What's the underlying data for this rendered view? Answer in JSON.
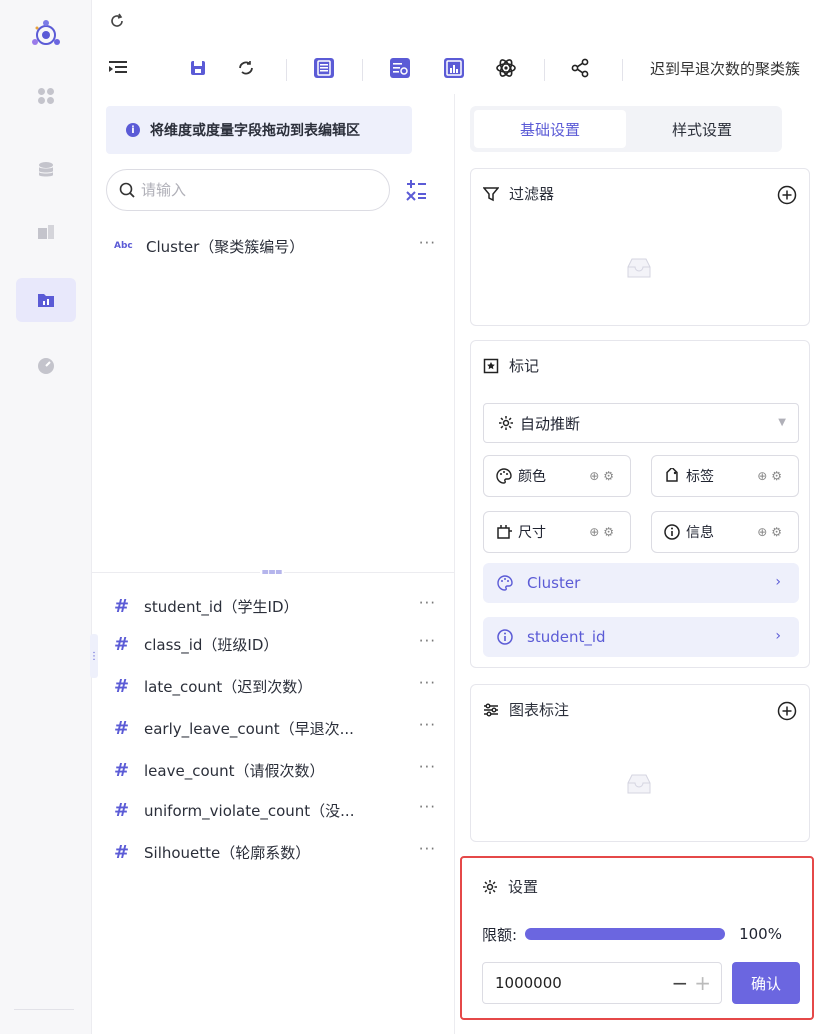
{
  "toolbar": {
    "chart_title": "迟到早退次数的聚类簇"
  },
  "fields_panel": {
    "banner_text": "将维度或度量字段拖动到表编辑区",
    "search_placeholder": "请输入",
    "dimensions": [
      {
        "type_badge": "Abc",
        "label": "Cluster（聚类簇编号）"
      }
    ],
    "measures": [
      {
        "label": "student_id（学生ID）"
      },
      {
        "label": "class_id（班级ID）"
      },
      {
        "label": "late_count（迟到次数）"
      },
      {
        "label": "early_leave_count（早退次..."
      },
      {
        "label": "leave_count（请假次数）"
      },
      {
        "label": "uniform_violate_count（没..."
      },
      {
        "label": "Silhouette（轮廓系数）"
      }
    ],
    "more_label": "···",
    "measure_symbol": "#"
  },
  "config_panel": {
    "tabs": [
      {
        "label": "基础设置",
        "active": true
      },
      {
        "label": "样式设置",
        "active": false
      }
    ],
    "filter": {
      "title": "过滤器"
    },
    "marks": {
      "title": "标记",
      "select_value": "自动推断",
      "chips": [
        {
          "label": "颜色",
          "icon": "palette-icon"
        },
        {
          "label": "标签",
          "icon": "tag-icon"
        },
        {
          "label": "尺寸",
          "icon": "size-icon"
        },
        {
          "label": "信息",
          "icon": "info-icon"
        }
      ],
      "pills": [
        {
          "label": "Cluster",
          "icon": "palette-icon"
        },
        {
          "label": "student_id",
          "icon": "info-icon"
        }
      ]
    },
    "annotation": {
      "title": "图表标注"
    },
    "settings": {
      "title": "设置",
      "limit_label": "限额:",
      "limit_percent_text": "100%",
      "limit_fraction": 1.0,
      "input_value": "1000000",
      "confirm_label": "确认"
    }
  },
  "colors": {
    "accent": "#6b66e0",
    "accent_soft": "#eef0fb",
    "highlight_border": "#e54848"
  }
}
